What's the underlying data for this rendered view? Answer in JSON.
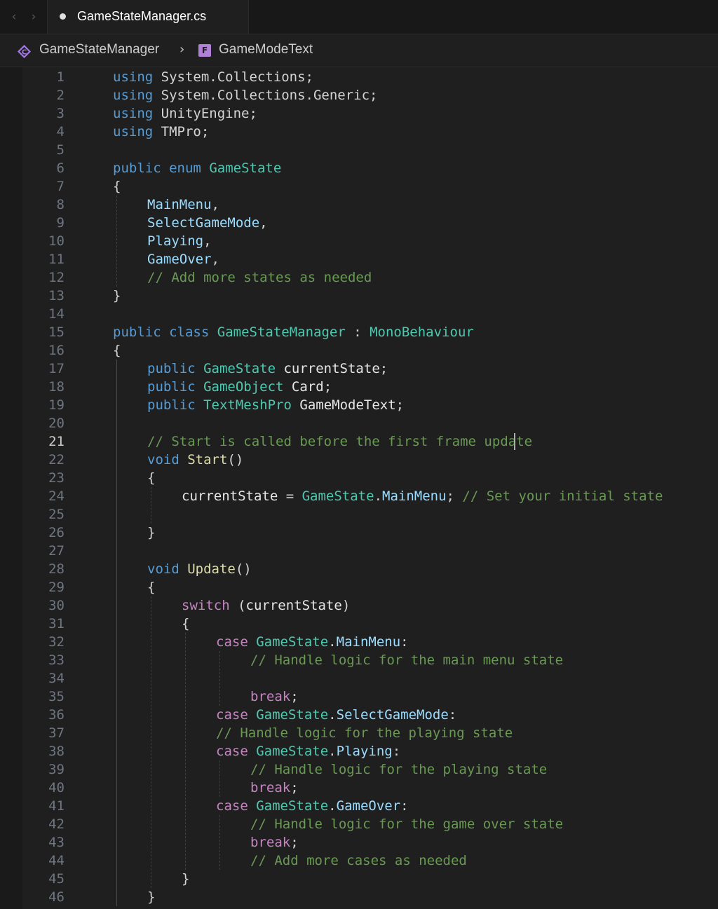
{
  "tabs": {
    "active": {
      "label": "GameStateManager.cs",
      "modified": true
    },
    "nav": {
      "back": "‹",
      "forward": "›"
    }
  },
  "breadcrumb": {
    "items": [
      {
        "label": "GameStateManager",
        "icon": "class-icon"
      },
      {
        "label": "GameModeText",
        "icon": "field-icon",
        "badge": "F"
      }
    ],
    "separator": "›"
  },
  "editor": {
    "active_line": 21,
    "colors": {
      "keyword": "#569cd6",
      "control": "#c586c0",
      "type": "#4ec9b0",
      "enum_member": "#9cdcfe",
      "function": "#dcdcaa",
      "comment": "#6a9955"
    },
    "lines": [
      {
        "n": "1",
        "indent": 0,
        "tokens": [
          [
            "kw",
            "using"
          ],
          [
            "ns",
            " System.Collections;"
          ]
        ]
      },
      {
        "n": "2",
        "indent": 0,
        "tokens": [
          [
            "kw",
            "using"
          ],
          [
            "ns",
            " System.Collections.Generic;"
          ]
        ]
      },
      {
        "n": "3",
        "indent": 0,
        "tokens": [
          [
            "kw",
            "using"
          ],
          [
            "ns",
            " UnityEngine;"
          ]
        ]
      },
      {
        "n": "4",
        "indent": 0,
        "tokens": [
          [
            "kw",
            "using"
          ],
          [
            "ns",
            " TMPro;"
          ]
        ]
      },
      {
        "n": "5",
        "indent": 0,
        "tokens": []
      },
      {
        "n": "6",
        "indent": 0,
        "tokens": [
          [
            "kw",
            "public"
          ],
          [
            "p",
            " "
          ],
          [
            "kw",
            "enum"
          ],
          [
            "p",
            " "
          ],
          [
            "type",
            "GameState"
          ]
        ]
      },
      {
        "n": "7",
        "indent": 0,
        "tokens": [
          [
            "p",
            "{"
          ]
        ]
      },
      {
        "n": "8",
        "indent": 1,
        "tokens": [
          [
            "enum",
            "MainMenu"
          ],
          [
            "p",
            ","
          ]
        ]
      },
      {
        "n": "9",
        "indent": 1,
        "tokens": [
          [
            "enum",
            "SelectGameMode"
          ],
          [
            "p",
            ","
          ]
        ]
      },
      {
        "n": "10",
        "indent": 1,
        "tokens": [
          [
            "enum",
            "Playing"
          ],
          [
            "p",
            ","
          ]
        ]
      },
      {
        "n": "11",
        "indent": 1,
        "tokens": [
          [
            "enum",
            "GameOver"
          ],
          [
            "p",
            ","
          ]
        ]
      },
      {
        "n": "12",
        "indent": 1,
        "tokens": [
          [
            "cm",
            "// Add more states as needed"
          ]
        ]
      },
      {
        "n": "13",
        "indent": 0,
        "tokens": [
          [
            "p",
            "}"
          ]
        ]
      },
      {
        "n": "14",
        "indent": 0,
        "tokens": []
      },
      {
        "n": "15",
        "indent": 0,
        "tokens": [
          [
            "kw",
            "public"
          ],
          [
            "p",
            " "
          ],
          [
            "kw",
            "class"
          ],
          [
            "p",
            " "
          ],
          [
            "type",
            "GameStateManager"
          ],
          [
            "p",
            " : "
          ],
          [
            "type",
            "MonoBehaviour"
          ]
        ]
      },
      {
        "n": "16",
        "indent": 0,
        "tokens": [
          [
            "p",
            "{"
          ]
        ]
      },
      {
        "n": "17",
        "indent": 1,
        "tokens": [
          [
            "kw",
            "public"
          ],
          [
            "p",
            " "
          ],
          [
            "type",
            "GameState"
          ],
          [
            "var",
            " currentState"
          ],
          [
            "p",
            ";"
          ]
        ]
      },
      {
        "n": "18",
        "indent": 1,
        "tokens": [
          [
            "kw",
            "public"
          ],
          [
            "p",
            " "
          ],
          [
            "type",
            "GameObject"
          ],
          [
            "var",
            " Card"
          ],
          [
            "p",
            ";"
          ]
        ]
      },
      {
        "n": "19",
        "indent": 1,
        "tokens": [
          [
            "kw",
            "public"
          ],
          [
            "p",
            " "
          ],
          [
            "type",
            "TextMeshPro"
          ],
          [
            "var",
            " GameModeText"
          ],
          [
            "p",
            ";"
          ]
        ]
      },
      {
        "n": "20",
        "indent": 0,
        "tokens": []
      },
      {
        "n": "21",
        "indent": 1,
        "tokens": [
          [
            "cm",
            "// Start is called before the first frame update"
          ]
        ]
      },
      {
        "n": "22",
        "indent": 1,
        "tokens": [
          [
            "kw",
            "void"
          ],
          [
            "p",
            " "
          ],
          [
            "fn",
            "Start"
          ],
          [
            "p",
            "()"
          ]
        ]
      },
      {
        "n": "23",
        "indent": 1,
        "tokens": [
          [
            "p",
            "{"
          ]
        ]
      },
      {
        "n": "24",
        "indent": 2,
        "tokens": [
          [
            "var",
            "currentState"
          ],
          [
            "p",
            " = "
          ],
          [
            "type",
            "GameState"
          ],
          [
            "p",
            "."
          ],
          [
            "enum",
            "MainMenu"
          ],
          [
            "p",
            "; "
          ],
          [
            "cm",
            "// Set your initial state"
          ]
        ]
      },
      {
        "n": "25",
        "indent": 0,
        "tokens": []
      },
      {
        "n": "26",
        "indent": 1,
        "tokens": [
          [
            "p",
            "}"
          ]
        ]
      },
      {
        "n": "27",
        "indent": 0,
        "tokens": []
      },
      {
        "n": "28",
        "indent": 1,
        "tokens": [
          [
            "kw",
            "void"
          ],
          [
            "p",
            " "
          ],
          [
            "fn",
            "Update"
          ],
          [
            "p",
            "()"
          ]
        ]
      },
      {
        "n": "29",
        "indent": 1,
        "tokens": [
          [
            "p",
            "{"
          ]
        ]
      },
      {
        "n": "30",
        "indent": 2,
        "tokens": [
          [
            "ctrl",
            "switch"
          ],
          [
            "p",
            " ("
          ],
          [
            "var",
            "currentState"
          ],
          [
            "p",
            ")"
          ]
        ]
      },
      {
        "n": "31",
        "indent": 2,
        "tokens": [
          [
            "p",
            "{"
          ]
        ]
      },
      {
        "n": "32",
        "indent": 3,
        "tokens": [
          [
            "ctrl",
            "case"
          ],
          [
            "p",
            " "
          ],
          [
            "type",
            "GameState"
          ],
          [
            "p",
            "."
          ],
          [
            "enum",
            "MainMenu"
          ],
          [
            "p",
            ":"
          ]
        ]
      },
      {
        "n": "33",
        "indent": 4,
        "tokens": [
          [
            "cm",
            "// Handle logic for the main menu state"
          ]
        ]
      },
      {
        "n": "34",
        "indent": 0,
        "tokens": []
      },
      {
        "n": "35",
        "indent": 4,
        "tokens": [
          [
            "ctrl",
            "break"
          ],
          [
            "p",
            ";"
          ]
        ]
      },
      {
        "n": "36",
        "indent": 3,
        "tokens": [
          [
            "ctrl",
            "case"
          ],
          [
            "p",
            " "
          ],
          [
            "type",
            "GameState"
          ],
          [
            "p",
            "."
          ],
          [
            "enum",
            "SelectGameMode"
          ],
          [
            "p",
            ":"
          ]
        ]
      },
      {
        "n": "37",
        "indent": 3,
        "tokens": [
          [
            "cm",
            "// Handle logic for the playing state"
          ]
        ]
      },
      {
        "n": "38",
        "indent": 3,
        "tokens": [
          [
            "ctrl",
            "case"
          ],
          [
            "p",
            " "
          ],
          [
            "type",
            "GameState"
          ],
          [
            "p",
            "."
          ],
          [
            "enum",
            "Playing"
          ],
          [
            "p",
            ":"
          ]
        ]
      },
      {
        "n": "39",
        "indent": 4,
        "tokens": [
          [
            "cm",
            "// Handle logic for the playing state"
          ]
        ]
      },
      {
        "n": "40",
        "indent": 4,
        "tokens": [
          [
            "ctrl",
            "break"
          ],
          [
            "p",
            ";"
          ]
        ]
      },
      {
        "n": "41",
        "indent": 3,
        "tokens": [
          [
            "ctrl",
            "case"
          ],
          [
            "p",
            " "
          ],
          [
            "type",
            "GameState"
          ],
          [
            "p",
            "."
          ],
          [
            "enum",
            "GameOver"
          ],
          [
            "p",
            ":"
          ]
        ]
      },
      {
        "n": "42",
        "indent": 4,
        "tokens": [
          [
            "cm",
            "// Handle logic for the game over state"
          ]
        ]
      },
      {
        "n": "43",
        "indent": 4,
        "tokens": [
          [
            "ctrl",
            "break"
          ],
          [
            "p",
            ";"
          ]
        ]
      },
      {
        "n": "44",
        "indent": 4,
        "tokens": [
          [
            "cm",
            "// Add more cases as needed"
          ]
        ]
      },
      {
        "n": "45",
        "indent": 2,
        "tokens": [
          [
            "p",
            "}"
          ]
        ]
      },
      {
        "n": "46",
        "indent": 1,
        "tokens": [
          [
            "p",
            "}"
          ]
        ]
      }
    ]
  }
}
